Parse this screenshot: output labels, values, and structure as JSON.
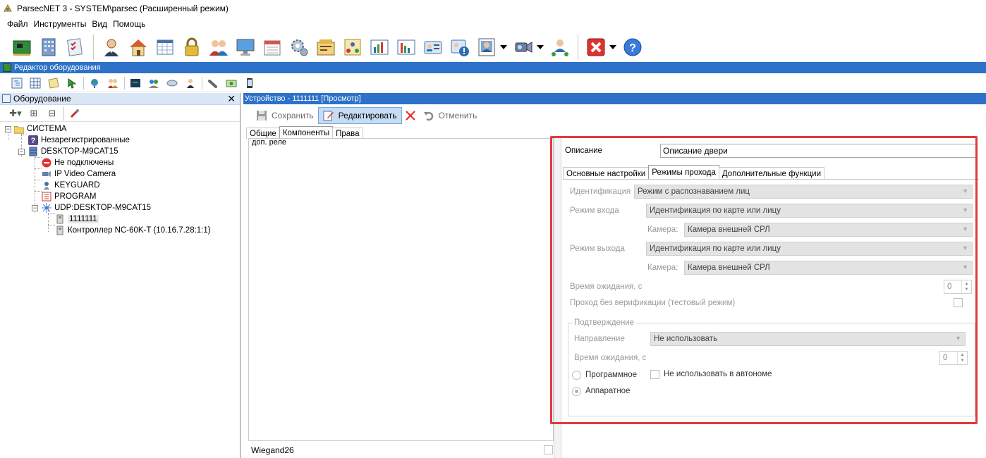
{
  "window": {
    "title": "ParsecNET 3 - SYSTEM\\parsec (Расширенный режим)"
  },
  "menu": [
    "Файл",
    "Инструменты",
    "Вид",
    "Помощь"
  ],
  "main_toolbar": {
    "icons": [
      "board-icon",
      "building-icon",
      "checklist-icon",
      "person-icon",
      "house-icon",
      "calendar-grid-icon",
      "lock-icon",
      "group-icon",
      "monitor-icon",
      "schedule-icon",
      "settings-gear-icon",
      "report-icon",
      "org-chart-icon",
      "bar-chart-icon",
      "bar-chart-2-icon",
      "id-card-icon",
      "warning-card-icon",
      "photo-icon",
      "camera-icon",
      "network-user-icon",
      "close-red-icon",
      "help-icon"
    ]
  },
  "editor": {
    "title": "Редактор оборудования"
  },
  "left_panel": {
    "title": "Оборудование",
    "tree": [
      {
        "label": "СИСТЕМА",
        "icon": "folder-icon"
      },
      {
        "label": "Незарегистрированные",
        "icon": "question-icon"
      },
      {
        "label": "DESKTOP-M9CAT15",
        "icon": "database-icon"
      },
      {
        "label": "Не подключены",
        "icon": "no-entry-icon"
      },
      {
        "label": "IP Video Camera",
        "icon": "camera-icon"
      },
      {
        "label": "KEYGUARD",
        "icon": "keyguard-icon"
      },
      {
        "label": "PROGRAM",
        "icon": "program-icon"
      },
      {
        "label": "UDP:DESKTOP-M9CAT15",
        "icon": "network-icon"
      },
      {
        "label": "1111111",
        "icon": "device-icon"
      },
      {
        "label": "Контроллер NC-60K-T (10.16.7.28:1:1)",
        "icon": "device-icon"
      }
    ]
  },
  "device": {
    "header": "Устройство - 1111111 [Просмотр]",
    "actions": {
      "save": "Сохранить",
      "edit": "Редактировать",
      "cancel": "Отменить"
    },
    "tabs": [
      "Общие",
      "Компоненты",
      "Права"
    ],
    "components_row": "доп. реле",
    "wiegand": "Wiegand26"
  },
  "settings": {
    "description_label": "Описание",
    "description_value": "Описание двери",
    "tabs": [
      "Основные настройки",
      "Режимы прохода",
      "Дополнительные функции"
    ],
    "identification_label": "Идентификация",
    "identification_value": "Режим с распознаванием лиц",
    "entry_mode_label": "Режим входа",
    "entry_mode_value": "Идентификация по карте или лицу",
    "camera_label": "Камера:",
    "entry_camera_value": "Камера внешней СРЛ",
    "exit_mode_label": "Режим выхода",
    "exit_mode_value": "Идентификация по карте или лицу",
    "exit_camera_value": "Камера внешней СРЛ",
    "wait_time_label": "Время ожидания, с",
    "wait_time_value": "0",
    "no_verify_label": "Проход без верификации (тестовый режим)",
    "confirm_group": "Подтверждение",
    "direction_label": "Направление",
    "direction_value": "Не использовать",
    "confirm_wait_label": "Время ожидания, с",
    "confirm_wait_value": "0",
    "software_label": "Программное",
    "no_autonomous_label": "Не использовать в автономе",
    "hardware_label": "Аппаратное"
  }
}
